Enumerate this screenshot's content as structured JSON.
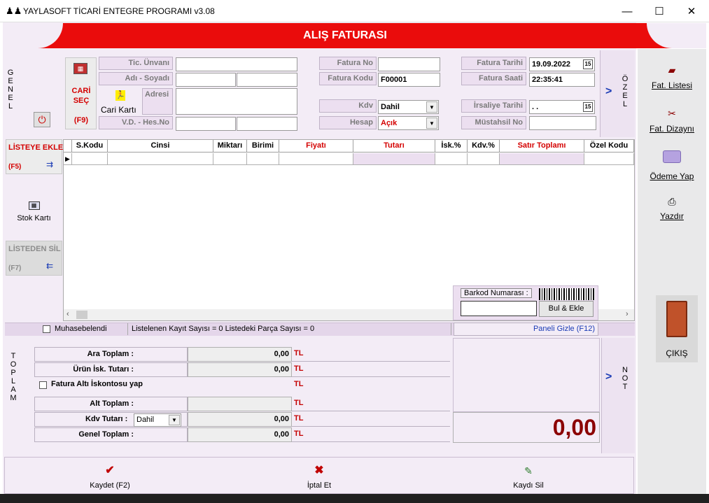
{
  "window": {
    "title": "YAYLASOFT TİCARİ ENTEGRE PROGRAMI v3.08",
    "minimize": "—",
    "maximize": "☐",
    "close": "✕"
  },
  "header": {
    "title": "ALIŞ FATURASI"
  },
  "side_genel": "G E N E L",
  "side_ozel": "Ö Z E L",
  "side_toplam": "T O P L A M",
  "side_not": "N O T",
  "arrow": ">",
  "cari": {
    "button_label": "CARİ SEÇ",
    "button_key": "(F9)",
    "kart_label": "Cari Kartı",
    "tic_unvani": "Tic. Ünvanı",
    "adi_soyadi": "Adı  - Soyadı",
    "adresi": "Adresi",
    "vd_hesno": "V.D. - Hes.No"
  },
  "fatura": {
    "no_label": "Fatura No",
    "no_value": "",
    "kodu_label": "Fatura Kodu",
    "kodu_value": "F00001",
    "kdv_label": "Kdv",
    "kdv_value": "Dahil",
    "hesap_label": "Hesap",
    "hesap_value": "Açık",
    "tarih_label": "Fatura Tarihi",
    "tarih_value": "19.09.2022",
    "saat_label": "Fatura Saati",
    "saat_value": "22:35:41",
    "irsaliye_label": "İrsaliye Tarihi",
    "irsaliye_value": " .  .",
    "mustahsil_label": "Müstahsil No",
    "mustahsil_value": ""
  },
  "left_actions": {
    "listeye_ekle": "LİSTEYE EKLE",
    "listeye_ekle_key": "(F5)",
    "stok_karti": "Stok Kartı",
    "listeden_sil": "LİSTEDEN SİL",
    "listeden_sil_key": "(F7)"
  },
  "grid": {
    "columns": [
      "S.Kodu",
      "Cinsi",
      "Miktarı",
      "Birimi",
      "Fiyatı",
      "Tutarı",
      "İsk.%",
      "Kdv.%",
      "Satır Toplamı",
      "Özel Kodu"
    ]
  },
  "barkod": {
    "label": "Barkod Numarası :",
    "value": "",
    "button": "Bul & Ekle"
  },
  "status": {
    "muhasebelendi": "Muhasebelendi",
    "info": "Listelenen Kayıt Sayısı = 0 Listedeki Parça Sayısı = 0",
    "paneli_gizle": "Paneli Gizle (F12)"
  },
  "totals": {
    "ara_toplam_label": "Ara Toplam :",
    "ara_toplam_value": "0,00",
    "urun_isk_label": "Ürün İsk. Tutarı :",
    "urun_isk_value": "0,00",
    "fatura_alti_label": "Fatura Altı İskontosu yap",
    "alt_toplam_label": "Alt Toplam :",
    "alt_toplam_value": "",
    "kdv_tutari_label": "Kdv Tutarı :",
    "kdv_select": "Dahil",
    "kdv_tutari_value": "0,00",
    "genel_toplam_label": "Genel Toplam :",
    "genel_toplam_value": "0,00",
    "currency": "TL",
    "big_total": "0,00"
  },
  "right_panel": {
    "fat_listesi": "Fat. Listesi",
    "fat_dizayni": "Fat. Dizaynı",
    "odeme_yap": "Ödeme Yap",
    "yazdir": "Yazdır",
    "cikis": "ÇIKIŞ"
  },
  "bottom": {
    "kaydet": "Kaydet (F2)",
    "iptal": "İptal Et",
    "kaydi_sil": "Kaydı Sil"
  },
  "colors": {
    "header_red": "#ea0c0c",
    "panel_bg": "#f3ecf6",
    "total_red": "#8b0000"
  }
}
